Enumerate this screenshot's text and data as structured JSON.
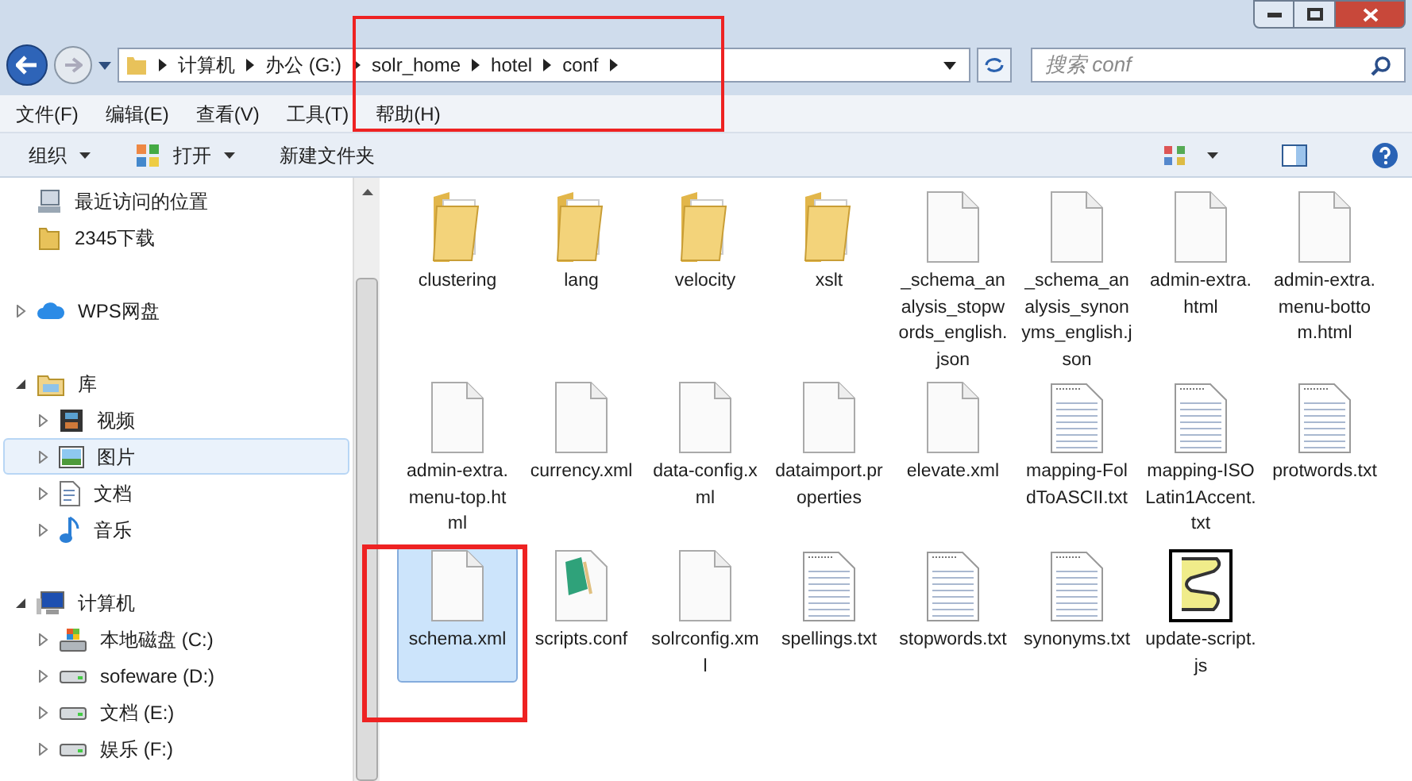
{
  "address": {
    "crumbs": [
      "计算机",
      "办公 (G:)",
      "solr_home",
      "hotel",
      "conf"
    ]
  },
  "search": {
    "placeholder": "搜索 conf"
  },
  "menu": [
    "文件(F)",
    "编辑(E)",
    "查看(V)",
    "工具(T)",
    "帮助(H)"
  ],
  "toolbar": [
    {
      "label": "组织",
      "kind": "dropdown"
    },
    {
      "label": "打开",
      "kind": "open"
    },
    {
      "label": "新建文件夹",
      "kind": "plain"
    }
  ],
  "nav": {
    "groups": [
      {
        "items": [
          {
            "label": "最近访问的位置",
            "kind": "recent",
            "selected": false
          },
          {
            "label": "2345下载",
            "kind": "folder",
            "selected": false
          }
        ]
      },
      {
        "items": [
          {
            "label": "WPS网盘",
            "kind": "cloud",
            "expanded": false,
            "selected": false
          }
        ]
      },
      {
        "items": [
          {
            "label": "库",
            "kind": "library",
            "expanded": true,
            "selected": false,
            "children": [
              {
                "label": "视频",
                "kind": "video",
                "expanded": false,
                "selected": false
              },
              {
                "label": "图片",
                "kind": "picture",
                "expanded": false,
                "selected": true
              },
              {
                "label": "文档",
                "kind": "document",
                "expanded": false,
                "selected": false
              },
              {
                "label": "音乐",
                "kind": "music",
                "expanded": false,
                "selected": false
              }
            ]
          }
        ]
      },
      {
        "items": [
          {
            "label": "计算机",
            "kind": "computer",
            "expanded": true,
            "selected": false,
            "children": [
              {
                "label": "本地磁盘 (C:)",
                "kind": "sysdrive",
                "expanded": false,
                "selected": false
              },
              {
                "label": "sofeware (D:)",
                "kind": "drive",
                "expanded": false,
                "selected": false
              },
              {
                "label": "文档 (E:)",
                "kind": "drive",
                "expanded": false,
                "selected": false
              },
              {
                "label": "娱乐 (F:)",
                "kind": "drive",
                "expanded": false,
                "selected": false
              }
            ]
          }
        ]
      }
    ]
  },
  "files": [
    {
      "name": "clustering",
      "kind": "folder",
      "selected": false
    },
    {
      "name": "lang",
      "kind": "folder",
      "selected": false
    },
    {
      "name": "velocity",
      "kind": "folder",
      "selected": false
    },
    {
      "name": "xslt",
      "kind": "folder",
      "selected": false
    },
    {
      "name": "_schema_analysis_stopwords_english.json",
      "kind": "file",
      "selected": false
    },
    {
      "name": "_schema_analysis_synonyms_english.json",
      "kind": "file",
      "selected": false
    },
    {
      "name": "admin-extra.html",
      "kind": "file",
      "selected": false
    },
    {
      "name": "admin-extra.menu-bottom.html",
      "kind": "file",
      "selected": false
    },
    {
      "name": "admin-extra.menu-top.html",
      "kind": "file",
      "selected": false
    },
    {
      "name": "currency.xml",
      "kind": "file",
      "selected": false
    },
    {
      "name": "data-config.xml",
      "kind": "file",
      "selected": false
    },
    {
      "name": "dataimport.properties",
      "kind": "file",
      "selected": false
    },
    {
      "name": "elevate.xml",
      "kind": "file",
      "selected": false
    },
    {
      "name": "mapping-FoldToASCII.txt",
      "kind": "text",
      "selected": false
    },
    {
      "name": "mapping-ISOLatin1Accent.txt",
      "kind": "text",
      "selected": false
    },
    {
      "name": "protwords.txt",
      "kind": "text",
      "selected": false
    },
    {
      "name": "schema.xml",
      "kind": "file",
      "selected": true
    },
    {
      "name": "scripts.conf",
      "kind": "conf",
      "selected": false
    },
    {
      "name": "solrconfig.xml",
      "kind": "file",
      "selected": false
    },
    {
      "name": "spellings.txt",
      "kind": "text",
      "selected": false
    },
    {
      "name": "stopwords.txt",
      "kind": "text",
      "selected": false
    },
    {
      "name": "synonyms.txt",
      "kind": "text",
      "selected": false
    },
    {
      "name": "update-script.js",
      "kind": "script",
      "selected": false
    }
  ]
}
